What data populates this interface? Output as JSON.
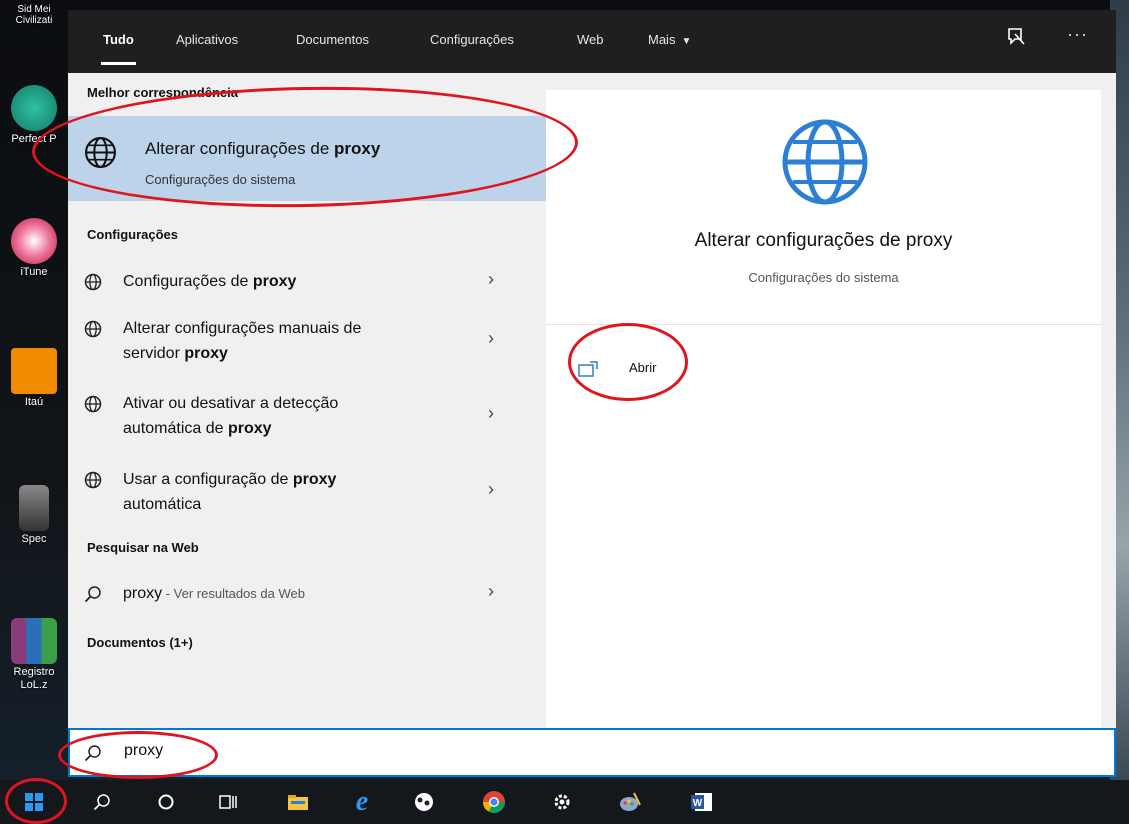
{
  "desktop_icons": [
    {
      "label": "Sid Mei\nCivilizati",
      "color": "#4a4a4a"
    },
    {
      "label": "Perfect P",
      "color": "#1a8f7a"
    },
    {
      "label": "iTune",
      "color": "#e23a62"
    },
    {
      "label": "Itaú",
      "color": "#f28a00"
    },
    {
      "label": "Spec",
      "color": "#555555"
    },
    {
      "label": "Registro\nLoL.z",
      "color": "#8a3b7a"
    }
  ],
  "tabs": {
    "all": "Tudo",
    "apps": "Aplicativos",
    "documents": "Documentos",
    "settings": "Configurações",
    "web": "Web",
    "more": "Mais"
  },
  "toolbar": {
    "dots": "···"
  },
  "best_match": {
    "section": "Melhor correspondência",
    "title_prefix": "Alterar configurações de ",
    "title_bold": "proxy",
    "subtitle": "Configurações do sistema"
  },
  "settings_section": "Configurações",
  "settings_items": [
    {
      "line1": "Configurações de ",
      "bold": "proxy",
      "line2": ""
    },
    {
      "line1": "Alterar configurações manuais de",
      "line2_prefix": "servidor ",
      "bold": "proxy"
    },
    {
      "line1": "Ativar ou desativar a detecção",
      "line2_prefix": "automática de ",
      "bold": "proxy"
    },
    {
      "line1_prefix": "Usar a configuração de ",
      "bold": "proxy",
      "line2": "automática"
    }
  ],
  "web_section": "Pesquisar na Web",
  "web_item": {
    "query": "proxy",
    "suffix": " - Ver resultados da Web"
  },
  "documents_section": "Documentos (1+)",
  "preview": {
    "title": "Alterar configurações de proxy",
    "subtitle": "Configurações do sistema",
    "open_label": "Abrir"
  },
  "search": {
    "value": "proxy"
  },
  "colors": {
    "accent": "#0078d7",
    "globe": "#2b7fd4",
    "highlight": "#bcd3ea",
    "annotation": "#e0141e"
  }
}
